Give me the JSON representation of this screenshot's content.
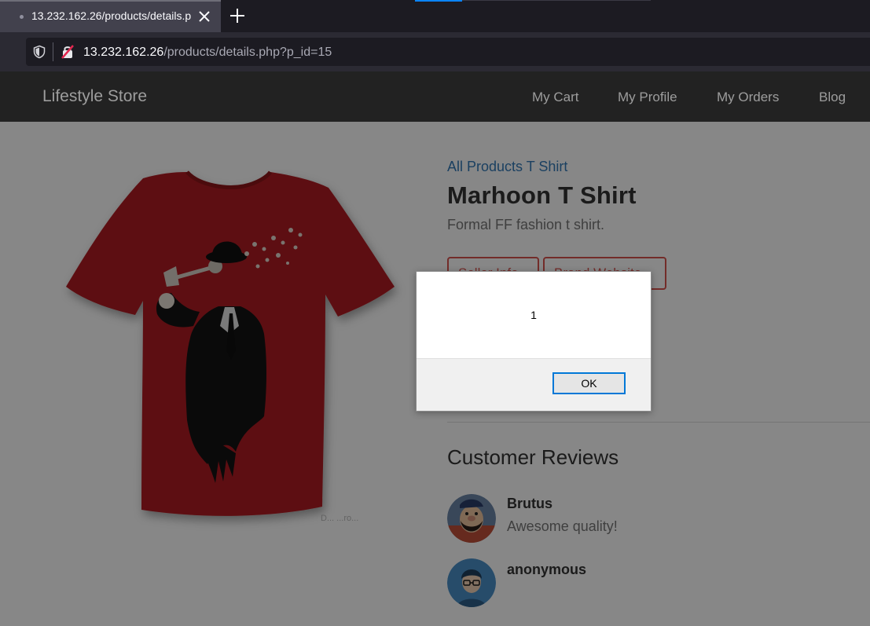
{
  "browser": {
    "tab_title": "13.232.162.26/products/details.php?p_id=15",
    "url_host": "13.232.162.26",
    "url_path": "/products/details.php?p_id=15"
  },
  "navbar": {
    "brand": "Lifestyle Store",
    "links": [
      "My Cart",
      "My Profile",
      "My Orders",
      "Blog"
    ]
  },
  "product": {
    "breadcrumb": "All Products T Shirt",
    "title": "Marhoon T Shirt",
    "description": "Formal FF fashion t shirt.",
    "buttons": [
      "Seller Info",
      "Brand Website"
    ],
    "image_watermark": "D... ...ro..."
  },
  "reviews": {
    "heading": "Customer Reviews",
    "items": [
      {
        "name": "Brutus",
        "text": "Awesome quality!"
      },
      {
        "name": "anonymous",
        "text": ""
      }
    ]
  },
  "dialog": {
    "message": "1",
    "ok_label": "OK"
  },
  "colors": {
    "navbar_bg": "#222222",
    "link_blue": "#337ab7",
    "button_red": "#d9534f",
    "shirt_red": "#b01e22",
    "dialog_focus": "#0078d7"
  }
}
